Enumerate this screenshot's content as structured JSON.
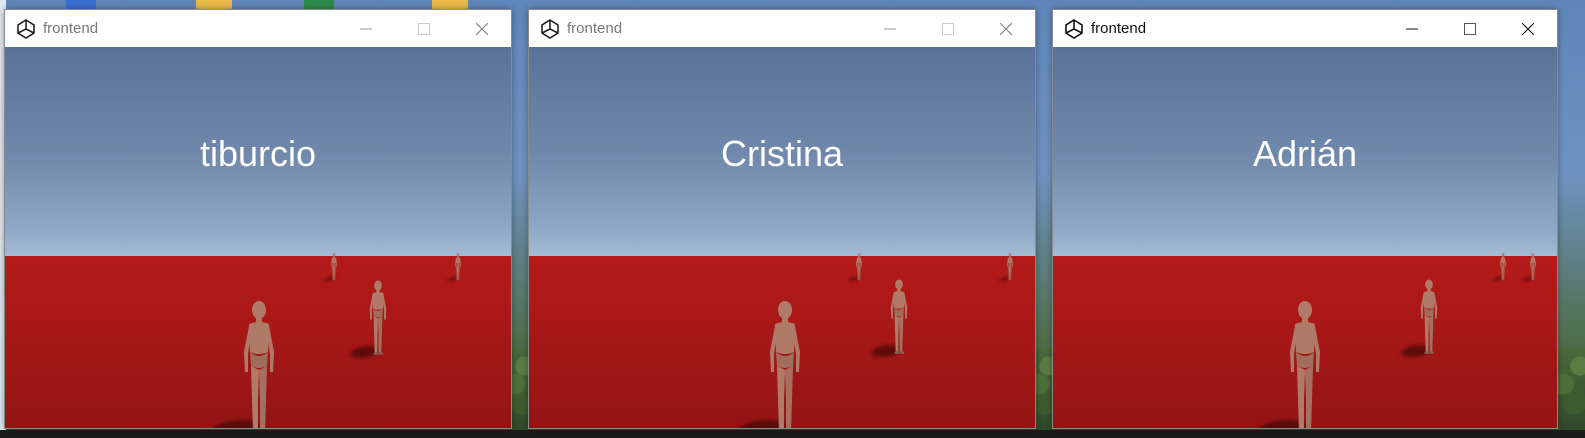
{
  "windows": [
    {
      "title": "frontend",
      "player_name": "tiburcio",
      "active": false,
      "controls": {
        "minimize": "minimize-icon",
        "maximize": "maximize-icon",
        "close": "close-icon"
      }
    },
    {
      "title": "frontend",
      "player_name": "Cristina",
      "active": false,
      "controls": {
        "minimize": "minimize-icon",
        "maximize": "maximize-icon",
        "close": "close-icon"
      }
    },
    {
      "title": "frontend",
      "player_name": "Adrián",
      "active": true,
      "controls": {
        "minimize": "minimize-icon",
        "maximize": "maximize-icon",
        "close": "close-icon"
      }
    }
  ],
  "scene": {
    "sky_top": "#5a7298",
    "sky_horizon": "#eef4f8",
    "ground_color": "#b41a18",
    "character_color": "#b07a68"
  }
}
